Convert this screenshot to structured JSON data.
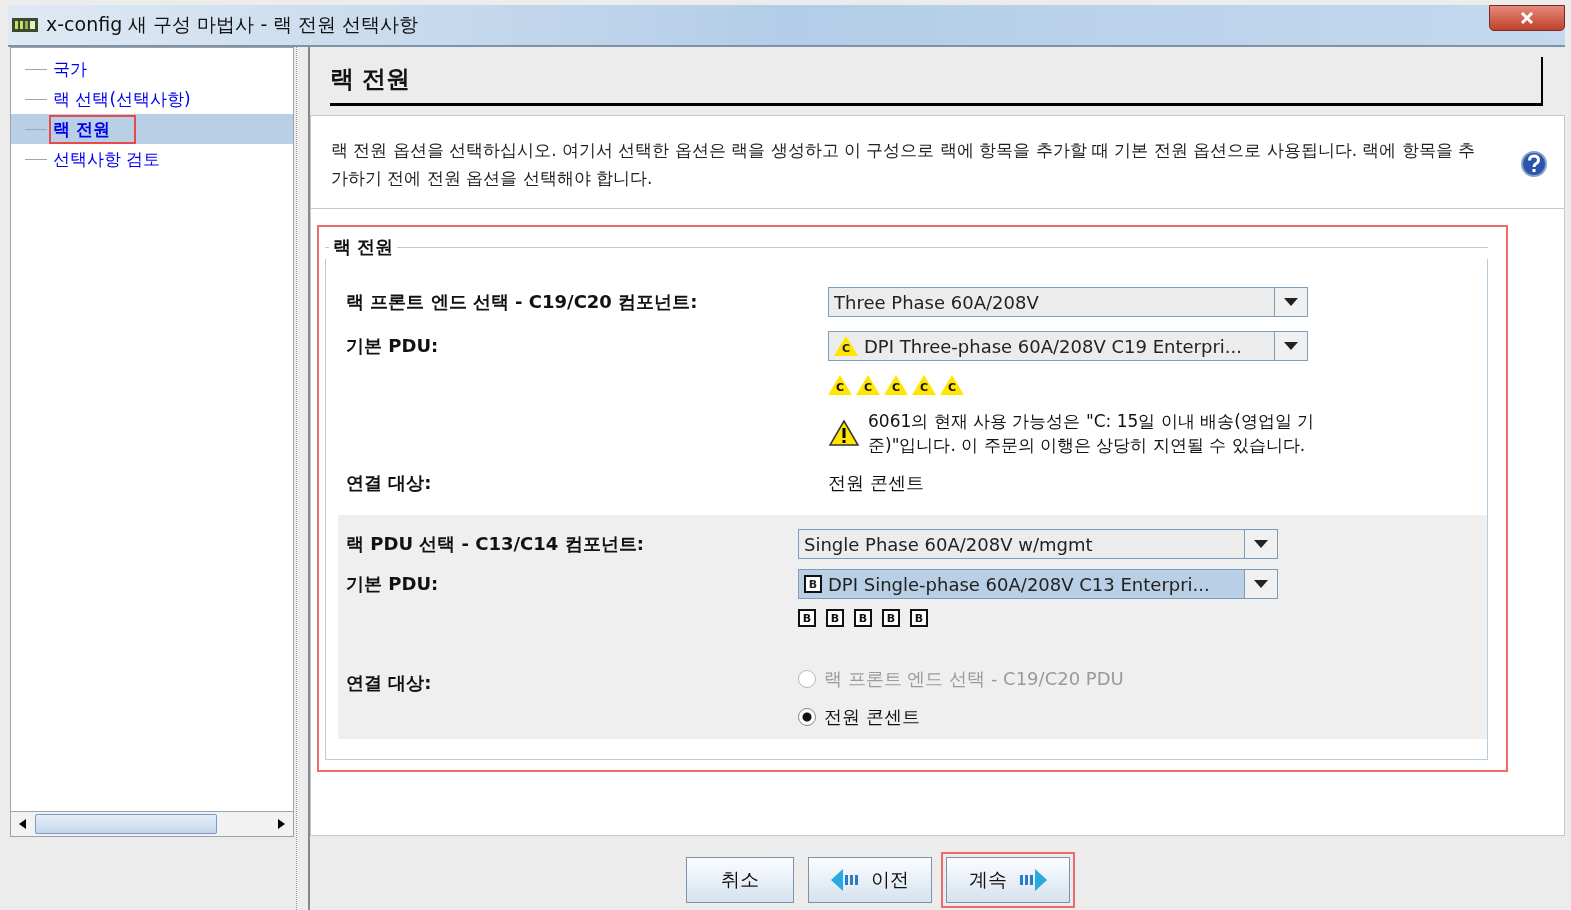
{
  "window": {
    "title": "x-config 새 구성 마법사 - 랙 전원 선택사항"
  },
  "sidebar": {
    "items": [
      {
        "label": "국가",
        "selected": false,
        "annotated": false
      },
      {
        "label": "랙 선택(선택사항)",
        "selected": false,
        "annotated": false
      },
      {
        "label": "랙 전원",
        "selected": true,
        "annotated": true
      },
      {
        "label": "선택사항 검토",
        "selected": false,
        "annotated": false
      }
    ]
  },
  "page_title": "랙 전원",
  "description": "랙 전원 옵션을 선택하십시오. 여기서 선택한 옵션은 랙을 생성하고 이 구성으로 랙에 항목을 추가할 때 기본 전원 옵션으로 사용됩니다. 랙에 항목을 추가하기 전에 전원 옵션을 선택해야 합니다.",
  "section": {
    "legend": "랙 전원",
    "annotated": true,
    "front_end": {
      "label": "랙 프론트 엔드 선택 - C19/C20 컴포넌트:",
      "value": "Three Phase 60A/208V",
      "highlighted": false
    },
    "front_pdu": {
      "label": "기본 PDU:",
      "value": "DPI Three-phase 60A/208V C19 Enterpri...",
      "badge": "C",
      "highlighted": false,
      "badges": [
        "C",
        "C",
        "C",
        "C",
        "C"
      ]
    },
    "warning": "6061의 현재 사용 가능성은 \"C: 15일 이내 배송(영업일 기준)\"입니다. 이 주문의 이행은 상당히 지연될 수 있습니다.",
    "front_connect": {
      "label": "연결 대상:",
      "value": "전원 콘센트"
    },
    "pdu": {
      "label": "랙 PDU 선택 - C13/C14 컴포넌트:",
      "value": "Single Phase 60A/208V w/mgmt",
      "highlighted": false
    },
    "pdu_default": {
      "label": "기본 PDU:",
      "value": "DPI Single-phase 60A/208V C13 Enterpri...",
      "badge": "B",
      "highlighted": true,
      "badges": [
        "B",
        "B",
        "B",
        "B",
        "B"
      ]
    },
    "pdu_connect": {
      "label": "연결 대상:",
      "options": [
        {
          "label": "랙 프론트 엔드 선택 - C19/C20 PDU",
          "selected": false,
          "disabled": true
        },
        {
          "label": "전원 콘센트",
          "selected": true,
          "disabled": false
        }
      ]
    }
  },
  "buttons": [
    {
      "label": "취소",
      "kind": "plain",
      "annotated": false
    },
    {
      "label": "이전",
      "kind": "back",
      "annotated": false
    },
    {
      "label": "계속",
      "kind": "next",
      "annotated": true
    }
  ]
}
